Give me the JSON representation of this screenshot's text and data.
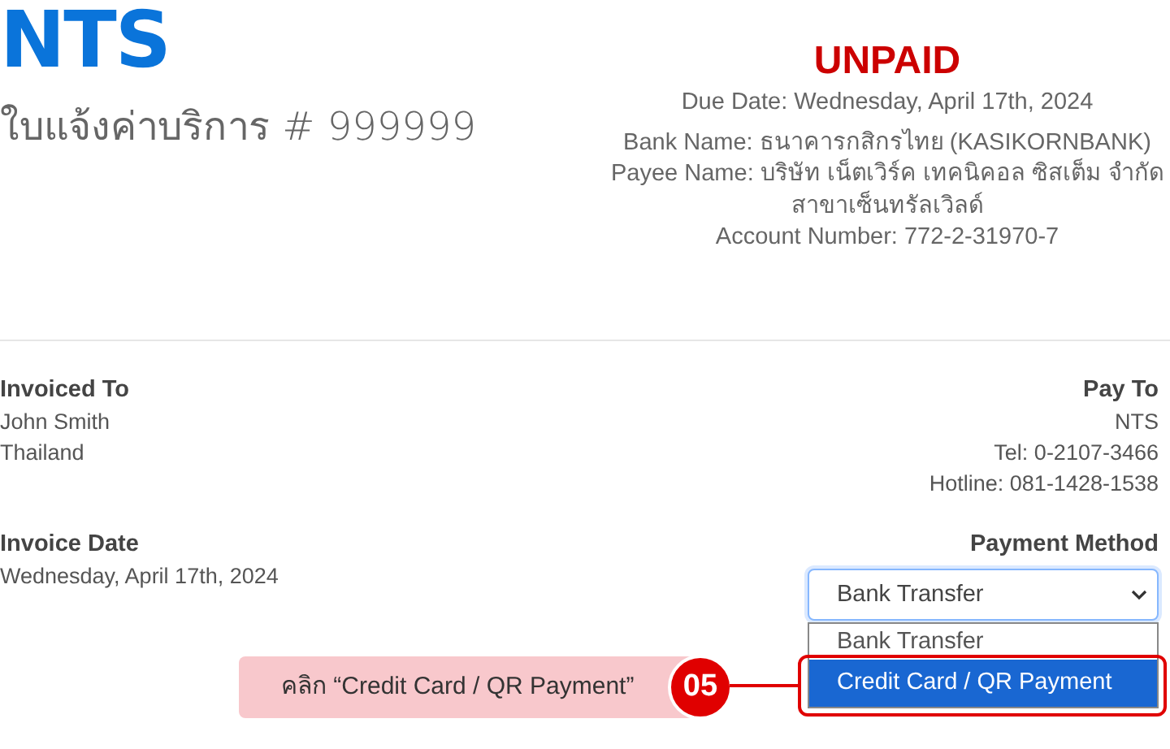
{
  "logo": "NTS",
  "title": "ใบแจ้งค่าบริการ # 999999",
  "status": {
    "text": "UNPAID",
    "kind": "unpaid"
  },
  "due_date": "Due Date: Wednesday, April 17th, 2024",
  "payment_info": [
    "Bank Name: ธนาคารกสิกรไทย (KASIKORNBANK)",
    "Payee Name: บริษัท เน็ตเวิร์ค เทคนิคอล ซิสเต็ม จำกัด สาขาเซ็นทรัลเวิลด์",
    "Account Number: 772-2-31970-7"
  ],
  "invoiced_to": {
    "heading": "Invoiced To",
    "lines": [
      "John Smith",
      "Thailand"
    ]
  },
  "pay_to": {
    "heading": "Pay To",
    "lines": [
      "NTS",
      "Tel: 0-2107-3466",
      "Hotline: 081-1428-1538"
    ]
  },
  "invoice_date": {
    "heading": "Invoice Date",
    "value": "Wednesday, April 17th, 2024"
  },
  "payment_method": {
    "heading": "Payment Method",
    "value": "Bank Transfer",
    "expanded": true,
    "options": [
      {
        "label": "Bank Transfer",
        "highlighted": false
      },
      {
        "label": "Credit Card / QR Payment",
        "highlighted": true
      }
    ]
  },
  "callout": {
    "label": "คลิก “Credit Card / QR Payment”",
    "step": "05"
  }
}
